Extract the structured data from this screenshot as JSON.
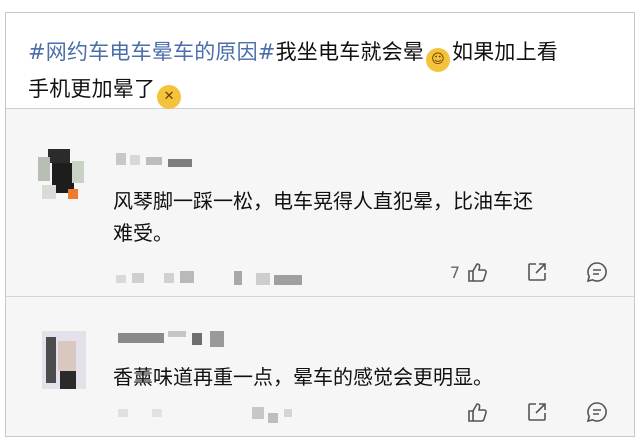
{
  "post": {
    "hashtag": "#网约车电车晕车的原因#",
    "text_line1": "我坐电车就会晕",
    "text_line1b": "如果加上看",
    "text_line2": "手机更加晕了",
    "emoji1": "hand-over-mouth-emoji",
    "emoji2": "dizzy-face-emoji"
  },
  "comments": [
    {
      "text_l1": "风琴脚一踩一松，电车晃得人直犯晕，比油车还",
      "text_l2": "难受。",
      "like_count": "7"
    },
    {
      "text_l1": "香薰味道再重一点，晕车的感觉会更明显。",
      "like_count": ""
    }
  ],
  "colors": {
    "hashtag": "#4a6ea9",
    "background": "#f6f6f6"
  },
  "icons": [
    "like-icon",
    "share-icon",
    "comment-icon"
  ]
}
